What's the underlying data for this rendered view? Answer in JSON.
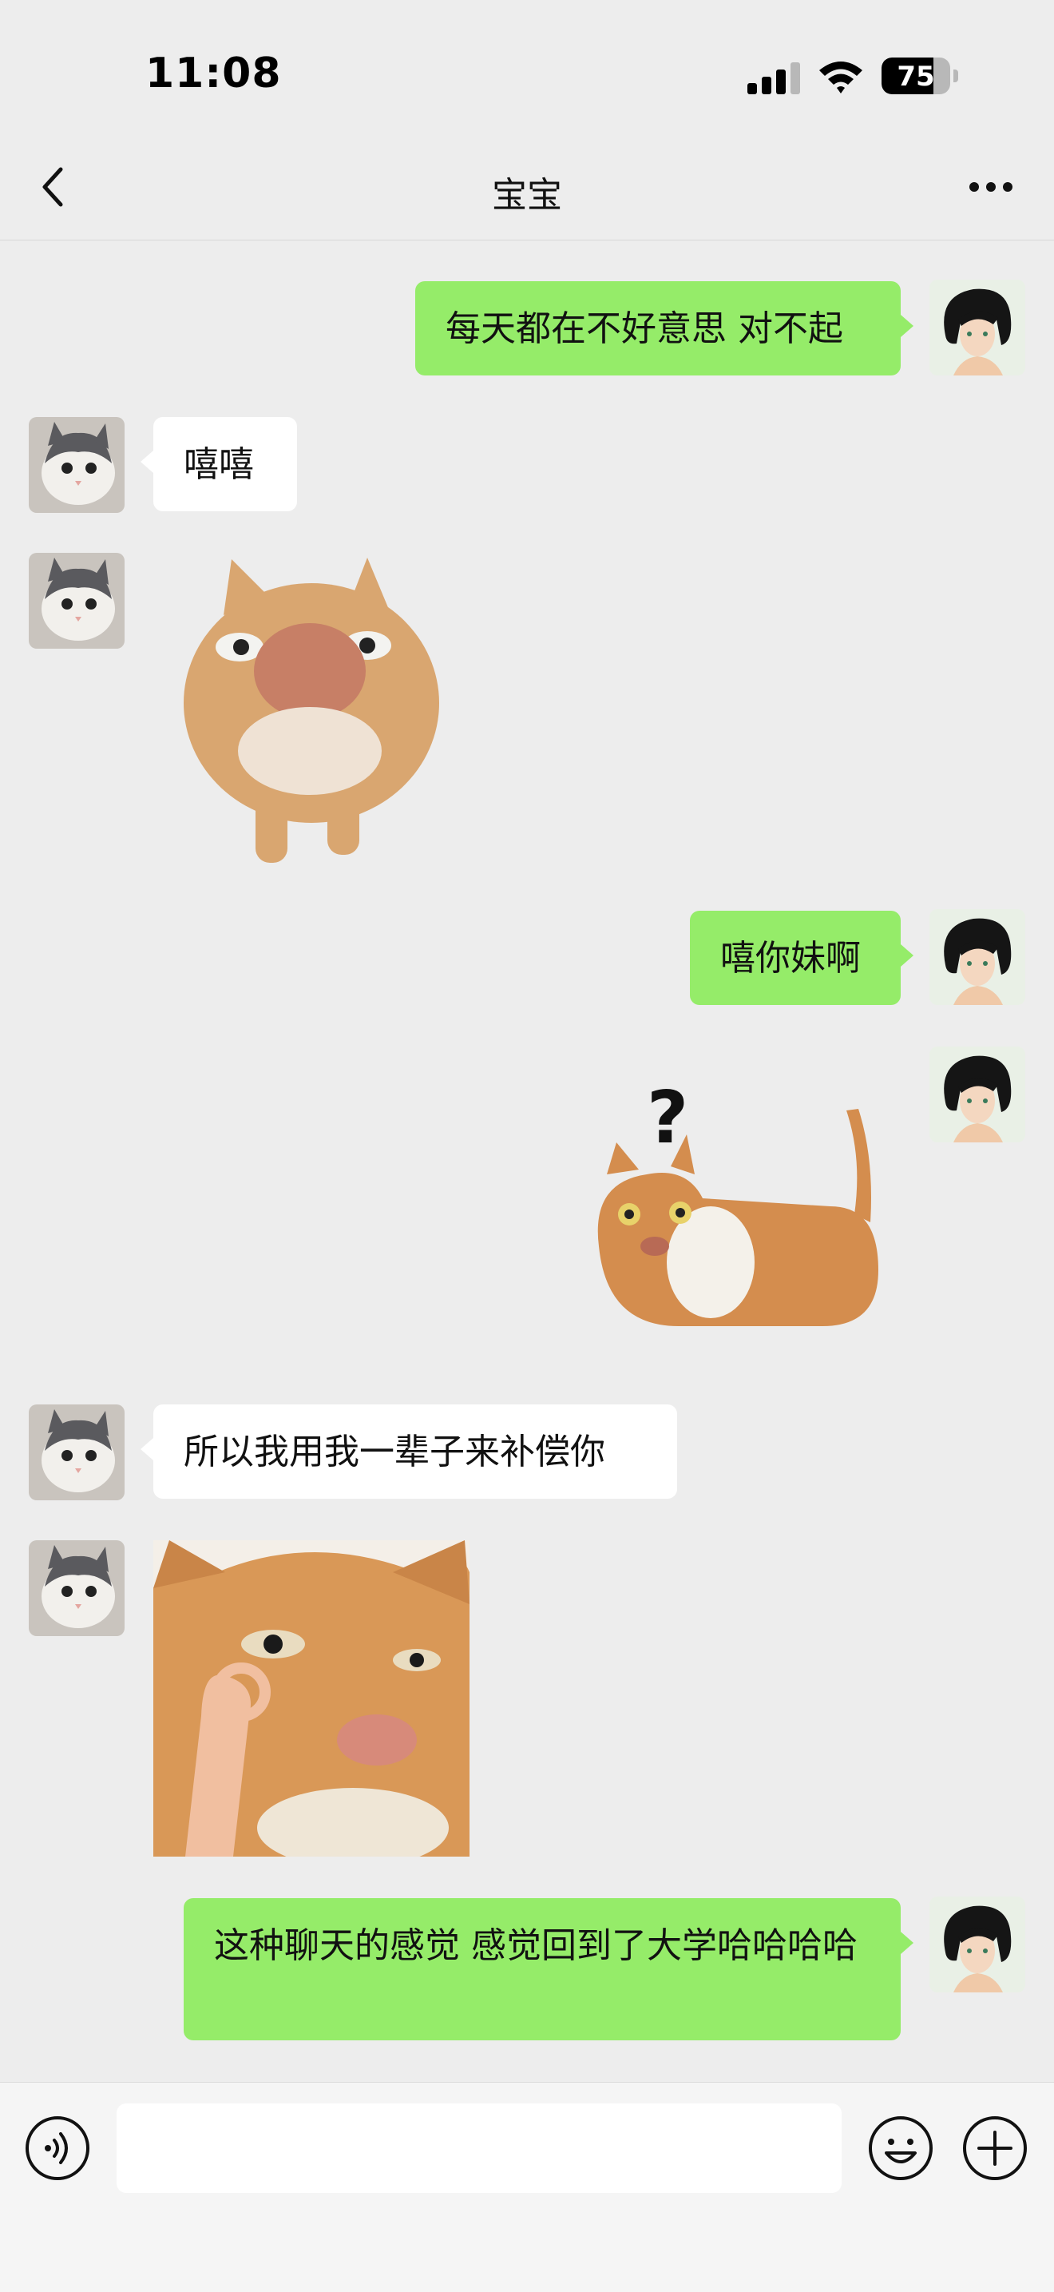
{
  "status": {
    "time": "11:08",
    "battery": "75",
    "battery_level": 0.75
  },
  "nav": {
    "title": "宝宝"
  },
  "messages": [
    {
      "text": "每天都在不好意思 对不起"
    },
    {
      "text": "嘻嘻"
    },
    {
      "text": "嘻你妹啊"
    },
    {
      "sticker_text": "?"
    },
    {
      "text": "所以我用我一辈子来补偿你"
    },
    {
      "text": "这种聊天的感觉 感觉回到了大学哈哈哈哈"
    }
  ],
  "icons": {
    "back": "chevron-left-icon",
    "more": "more-icon",
    "voice": "voice-icon",
    "emoji": "emoji-icon",
    "add": "plus-icon"
  },
  "colors": {
    "outgoing_bubble": "#95ec69",
    "incoming_bubble": "#ffffff",
    "background": "#ededed"
  }
}
